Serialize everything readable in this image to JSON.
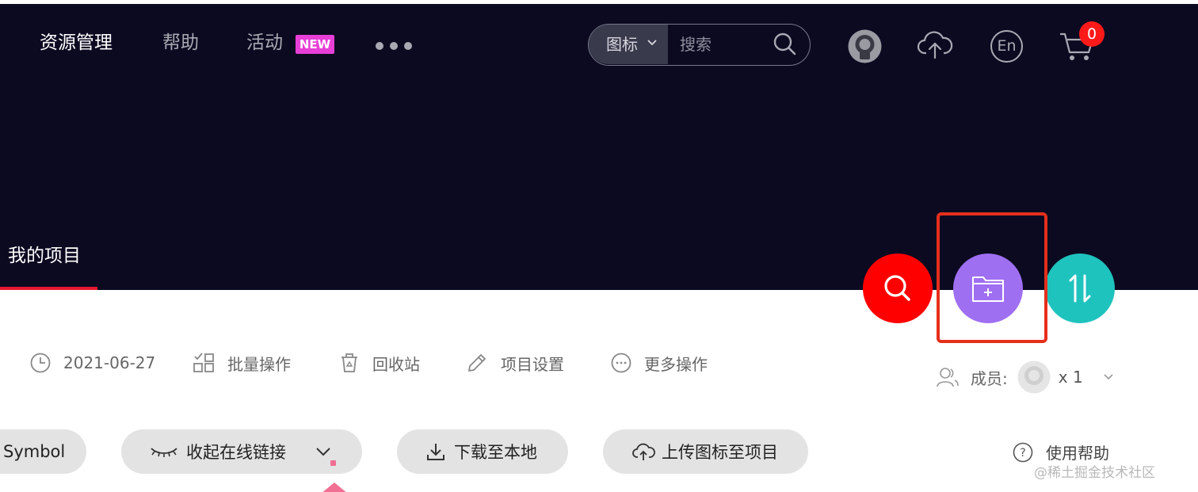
{
  "header": {
    "nav": [
      {
        "label": "资源管理",
        "active": true
      },
      {
        "label": "帮助"
      },
      {
        "label": "活动"
      }
    ],
    "new_badge": "NEW",
    "more_icon": "more-dots-icon",
    "search": {
      "type_label": "图标",
      "placeholder": "搜索"
    },
    "icons": [
      "avatar-icon",
      "cloud-upload-icon",
      "language-en-icon",
      "cart-icon"
    ],
    "language_label": "En",
    "cart_count": "0"
  },
  "tab": {
    "label": "我的项目",
    "accent_color": "#e6172f"
  },
  "fabs": {
    "search_color": "#ff0000",
    "new_folder_color": "#9f6ff2",
    "sort_color": "#1fc3be"
  },
  "toolbar": {
    "date": "2021-06-27",
    "batch": "批量操作",
    "recycle": "回收站",
    "settings": "项目设置",
    "more": "更多操作"
  },
  "members": {
    "label": "成员:",
    "count": "x 1"
  },
  "actions": {
    "symbol": "Symbol",
    "collapse_link": "收起在线链接",
    "download": "下载至本地",
    "upload": "上传图标至项目"
  },
  "help": {
    "label": "使用帮助"
  },
  "watermark": "@稀土掘金技术社区"
}
